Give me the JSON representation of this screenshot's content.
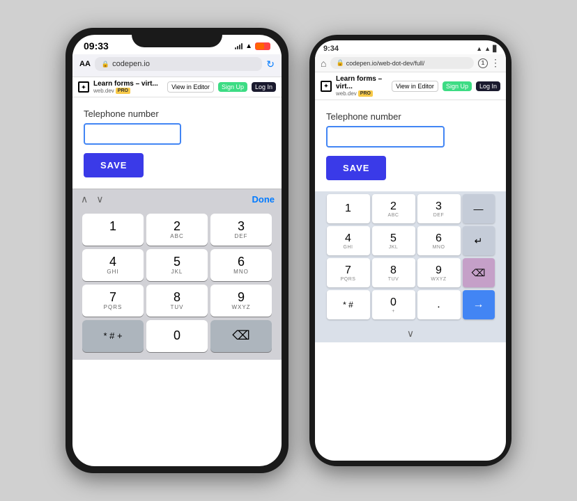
{
  "left_phone": {
    "status_bar": {
      "time": "09:33"
    },
    "browser": {
      "url": "codepen.io",
      "lock": "🔒"
    },
    "codepen": {
      "title": "Learn forms – virt...",
      "subtitle": "web.dev",
      "pro_label": "PRO",
      "view_in_editor": "View in Editor",
      "sign_up": "Sign Up",
      "log_in": "Log In"
    },
    "form": {
      "label": "Telephone number",
      "save_button": "SAVE"
    },
    "keyboard": {
      "done_label": "Done",
      "keys": [
        {
          "num": "1",
          "letters": ""
        },
        {
          "num": "2",
          "letters": "ABC"
        },
        {
          "num": "3",
          "letters": "DEF"
        },
        {
          "num": "4",
          "letters": "GHI"
        },
        {
          "num": "5",
          "letters": "JKL"
        },
        {
          "num": "6",
          "letters": "MNO"
        },
        {
          "num": "7",
          "letters": "PQRS"
        },
        {
          "num": "8",
          "letters": "TUV"
        },
        {
          "num": "9",
          "letters": "WXYZ"
        },
        {
          "num": "* # +",
          "letters": ""
        },
        {
          "num": "0",
          "letters": ""
        },
        {
          "num": "⌫",
          "letters": ""
        }
      ]
    }
  },
  "right_phone": {
    "status_bar": {
      "time": "9:34"
    },
    "browser": {
      "url": "codepen.io/web-dot-dev/full/",
      "lock": "🔒",
      "home_icon": "⌂"
    },
    "codepen": {
      "title": "Learn forms – virt...",
      "subtitle": "web.dev",
      "pro_label": "PRO",
      "view_in_editor": "View in Editor",
      "sign_up": "Sign Up",
      "log_in": "Log In"
    },
    "form": {
      "label": "Telephone number",
      "save_button": "SAVE"
    },
    "keyboard": {
      "keys": [
        {
          "num": "1",
          "letters": ""
        },
        {
          "num": "2",
          "letters": "ABC"
        },
        {
          "num": "3",
          "letters": "DEF"
        },
        {
          "num": "4",
          "letters": "GHI"
        },
        {
          "num": "5",
          "letters": "JKL"
        },
        {
          "num": "6",
          "letters": "MNO"
        },
        {
          "num": "7",
          "letters": "PQRS"
        },
        {
          "num": "8",
          "letters": "TUV"
        },
        {
          "num": "9",
          "letters": "WXYZ"
        },
        {
          "num": "* #",
          "letters": ""
        },
        {
          "num": "0",
          "letters": "+"
        },
        {
          "num": ".",
          "letters": ""
        }
      ],
      "backspace": "⌫",
      "arrow": "→",
      "minus": "—",
      "enter": "↵",
      "handle": "∨"
    }
  }
}
